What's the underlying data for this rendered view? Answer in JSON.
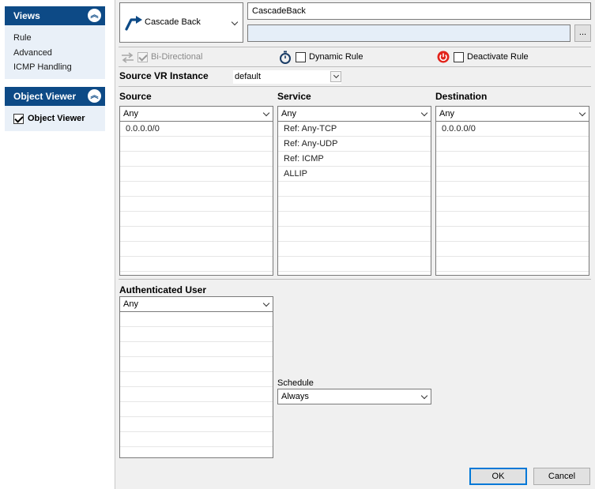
{
  "sidebar": {
    "views": {
      "title": "Views",
      "items": [
        "Rule",
        "Advanced",
        "ICMP Handling"
      ]
    },
    "object_viewer": {
      "title": "Object Viewer",
      "checkbox_label": "Object Viewer",
      "checked": true
    }
  },
  "rule": {
    "type_label": "Cascade Back",
    "name_value": "CascadeBack",
    "description_value": "",
    "browse_label": "..."
  },
  "options": {
    "bidirectional": "Bi-Directional",
    "dynamic_rule": "Dynamic Rule",
    "deactivate_rule": "Deactivate Rule"
  },
  "source_vr": {
    "label": "Source VR Instance",
    "value": "default"
  },
  "source": {
    "label": "Source",
    "selected": "Any",
    "items": [
      "0.0.0.0/0"
    ]
  },
  "service": {
    "label": "Service",
    "selected": "Any",
    "items": [
      "Ref: Any-TCP",
      "Ref: Any-UDP",
      "Ref: ICMP",
      "ALLIP"
    ]
  },
  "destination": {
    "label": "Destination",
    "selected": "Any",
    "items": [
      "0.0.0.0/0"
    ]
  },
  "auth_user": {
    "label": "Authenticated User",
    "selected": "Any",
    "items": []
  },
  "schedule": {
    "label": "Schedule",
    "value": "Always"
  },
  "buttons": {
    "ok": "OK",
    "cancel": "Cancel"
  },
  "colors": {
    "accent": "#0d4a86",
    "power_red": "#e2231a"
  }
}
